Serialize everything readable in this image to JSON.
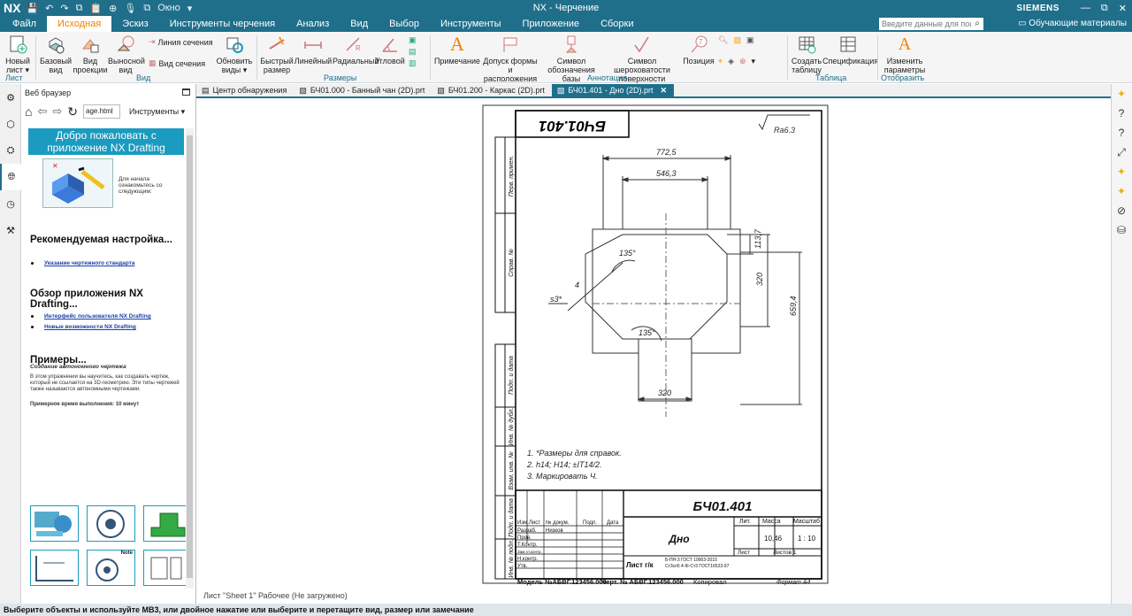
{
  "titlebar": {
    "logo": "NX",
    "window_menu": "Окно",
    "title": "NX - Черчение",
    "brand": "SIEMENS"
  },
  "menubar": {
    "items": [
      "Файл",
      "Исходная",
      "Эскиз",
      "Инструменты черчения",
      "Анализ",
      "Вид",
      "Выбор",
      "Инструменты",
      "Приложение",
      "Сборки"
    ],
    "active_index": 1,
    "search_placeholder": "Введите данные для поиска",
    "learning": "Обучающие материалы"
  },
  "ribbon": {
    "groups": {
      "sheet": "Лист",
      "view": "Вид",
      "dimensions": "Размеры",
      "annotation": "Аннотация",
      "table": "Таблица",
      "display": "Отобразить"
    },
    "buttons": {
      "new_sheet": "Новый лист",
      "base_view": "Базовый вид",
      "projection_view": "Вид проекции",
      "detail_view": "Выносной вид",
      "section_line": "Линия сечения",
      "section_view": "Вид сечения",
      "update_views": "Обновить виды",
      "rapid_dim": "Быстрый размер",
      "linear": "Линейный",
      "radial": "Радиальный",
      "angular": "Угловой",
      "note": "Примечание",
      "fcf": "Допуск формы и расположения",
      "datum": "Символ обозначения базы",
      "surface_finish": "Символ шероховатости поверхности",
      "balloon": "Позиция",
      "create_table": "Создать таблицу",
      "parts_list": "Спецификация",
      "edit_settings": "Изменить параметры"
    }
  },
  "browser": {
    "title": "Веб браузер",
    "url": "age.html",
    "tools": "Инструменты",
    "welcome": "Добро пожаловать с приложение NX Drafting",
    "welcome_text": "Для начала ознакомьтесь со следующим:",
    "section1": "Рекомендуемая настройка...",
    "link1": "Указание чертежного стандарта",
    "section2": "Обзор приложения NX Drafting...",
    "link2": "Интерфейс пользователя NX Drafting",
    "link3": "Новые возможности NX Drafting",
    "section3": "Примеры...",
    "example_title": "Создание автономного чертежа",
    "example_text": "В этом упражнении вы научитесь, как создавать чертеж, который не ссылается на 3D-геометрию. Эти типы чертежей также называются автономными чертежами.",
    "example_time": "Примерное время выполнения: 10 минут",
    "thumb_note": "Note"
  },
  "tabs": [
    {
      "label": "Центр обнаружения",
      "active": false
    },
    {
      "label": "БЧ01.000 - Банный чан (2D).prt",
      "active": false
    },
    {
      "label": "БЧ01.200 - Каркас (2D).prt",
      "active": false
    },
    {
      "label": "БЧ01.401 - Дно (2D).prt",
      "active": true
    }
  ],
  "drawing": {
    "stamp_top": "БЧ01.401",
    "roughness": "Ra6.3",
    "side_labels": [
      "Перв. примен.",
      "Справ. №",
      "Подп. и дата",
      "Инв. № дубл.",
      "Взам. инв. №",
      "Подп. и дата",
      "Инв. № подл."
    ],
    "dims": {
      "d_772": "772,5",
      "d_546": "546,3",
      "d_113": "113,7",
      "d_320v": "320",
      "d_659": "659,4",
      "d_320h": "320",
      "a_135a": "135°",
      "a_135b": "135°",
      "s3": "s3*",
      "four": "4"
    },
    "notes": [
      "1. *Размеры для справок.",
      "2. h14; H14; ±IT14/2.",
      "3. Маркировать Ч."
    ],
    "title_block": {
      "designation": "БЧ01.401",
      "name": "Дно",
      "lit": "Лит.",
      "mass": "Масса",
      "scale": "Масштаб",
      "mass_val": "10,46",
      "scale_val": "1 : 10",
      "sheet": "Лист",
      "sheets": "Листов 1",
      "material": "Лист г/к",
      "material_std1": "Б-ПН-3 ГОСТ 19903-2015",
      "material_std2": "Ст3сп5 4-III-Ст3 ГОСТ16523-97",
      "row_labels": [
        "Изм.",
        "Лист",
        "№ докум.",
        "Подп.",
        "Дата"
      ],
      "roles": [
        "Разраб.",
        "Пров.",
        "Т.Контр.",
        "Зам.гл.контр.",
        "Н.контр.",
        "Утв."
      ],
      "developer": "Низков",
      "model": "Модель №АБВГ.123456.000",
      "drawing_no": "Черт. № АБВГ.123456.000",
      "copied": "Копировал",
      "format": "Формат А4"
    }
  },
  "sheet_status": "Лист \"Sheet 1\" Рабочее (Не загружено)",
  "status": "Выберите объекты и используйте MB3, или двойное нажатие или выберите и перетащите вид, размер или замечание"
}
